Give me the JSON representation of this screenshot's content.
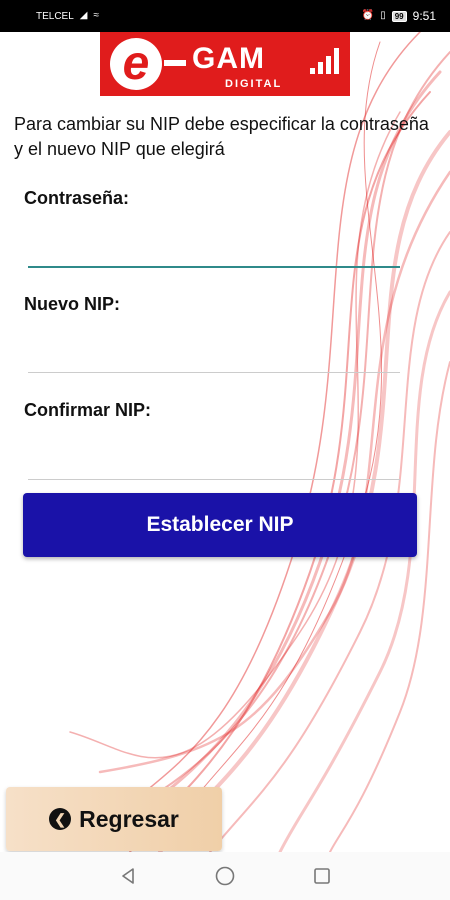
{
  "status_bar": {
    "carrier": "TELCEL",
    "battery": "99",
    "time": "9:51"
  },
  "logo": {
    "letter": "e",
    "name": "GAM",
    "subtitle": "DIGITAL"
  },
  "instructions": "Para cambiar su NIP debe especificar la contraseña y el nuevo NIP que elegirá",
  "form": {
    "password_label": "Contraseña:",
    "password_value": "",
    "new_nip_label": "Nuevo NIP:",
    "new_nip_value": "",
    "confirm_nip_label": "Confirmar NIP:",
    "confirm_nip_value": ""
  },
  "buttons": {
    "submit_label": "Establecer NIP",
    "back_label": "Regresar"
  },
  "icons": {
    "back": "circle-chevron-left-icon",
    "nav_back": "triangle-back-icon",
    "nav_home": "circle-home-icon",
    "nav_recents": "square-recents-icon"
  },
  "colors": {
    "primary_button": "#1a12a8",
    "logo_red": "#e01c1c",
    "back_button": "#f3d6b4",
    "active_underline": "#2f8a8a"
  }
}
